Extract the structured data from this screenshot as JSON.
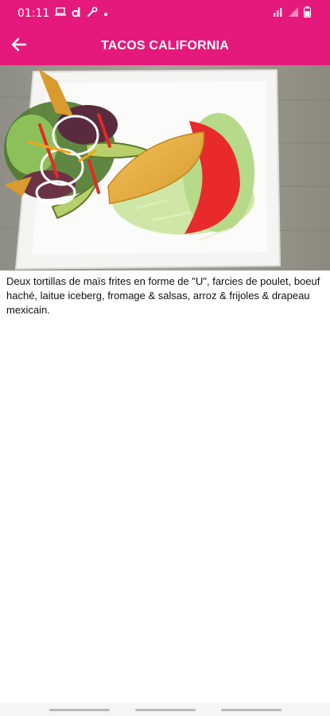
{
  "status_bar": {
    "time": "01:11",
    "left_icons": [
      "laptop-icon",
      "dailymotion-d-icon",
      "wrench-icon",
      "dot-icon"
    ],
    "right_icons": [
      "signal-icon",
      "signal-bars-icon",
      "battery-icon"
    ]
  },
  "app_bar": {
    "title": "TACOS CALIFORNIA",
    "back_icon": "arrow-left-icon"
  },
  "product": {
    "image_icon": "tacos-photo",
    "description": "Deux tortillas de maïs frites en forme de \"U\", farcies de poulet, boeuf haché, laitue iceberg, fromage & salsas, arroz & frijoles & drapeau mexicain."
  },
  "colors": {
    "primary": "#e5197b",
    "background": "#ffffff",
    "text": "#111111"
  }
}
